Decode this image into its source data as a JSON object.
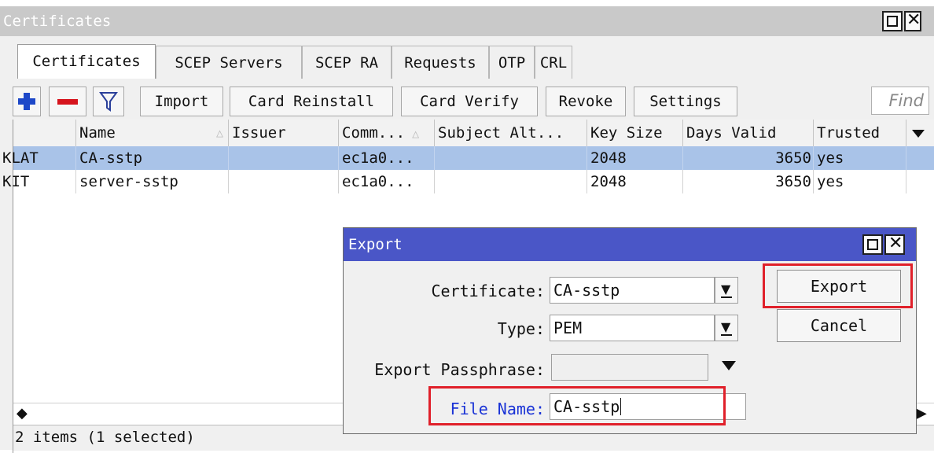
{
  "window": {
    "title": "Certificates"
  },
  "tabs": [
    {
      "label": "Certificates",
      "active": true
    },
    {
      "label": "SCEP Servers"
    },
    {
      "label": "SCEP RA"
    },
    {
      "label": "Requests"
    },
    {
      "label": "OTP"
    },
    {
      "label": "CRL"
    }
  ],
  "toolbar": {
    "icons": [
      "add-icon",
      "remove-icon",
      "filter-icon"
    ],
    "buttons": [
      "Import",
      "Card Reinstall",
      "Card Verify",
      "Revoke",
      "Settings"
    ],
    "find_placeholder": "Find"
  },
  "table": {
    "columns": [
      "",
      "Name",
      "Issuer",
      "Comm...",
      "Subject Alt...",
      "Key Size",
      "Days Valid",
      "Trusted"
    ],
    "rows": [
      {
        "flags": "KLAT",
        "name": "CA-sstp",
        "issuer": "",
        "common": "ec1a0...",
        "subject_alt": "",
        "key_size": "2048",
        "days_valid": "3650",
        "trusted": "yes",
        "selected": true
      },
      {
        "flags": "KIT",
        "name": "server-sstp",
        "issuer": "",
        "common": "ec1a0...",
        "subject_alt": "",
        "key_size": "2048",
        "days_valid": "3650",
        "trusted": "yes",
        "selected": false
      }
    ]
  },
  "status": {
    "text": "2 items (1 selected)"
  },
  "dialog": {
    "title": "Export",
    "certificate_label": "Certificate:",
    "certificate_value": "CA-sstp",
    "type_label": "Type:",
    "type_value": "PEM",
    "passphrase_label": "Export Passphrase:",
    "passphrase_value": "",
    "file_name_label": "File Name:",
    "file_name_value": "CA-sstp",
    "export_button": "Export",
    "cancel_button": "Cancel"
  },
  "colors": {
    "dialog_title_bg": "#4a56c7",
    "selected_row": "#a9c3e8",
    "highlight_box": "#e0202a",
    "file_name_label": "#1a33d6"
  }
}
